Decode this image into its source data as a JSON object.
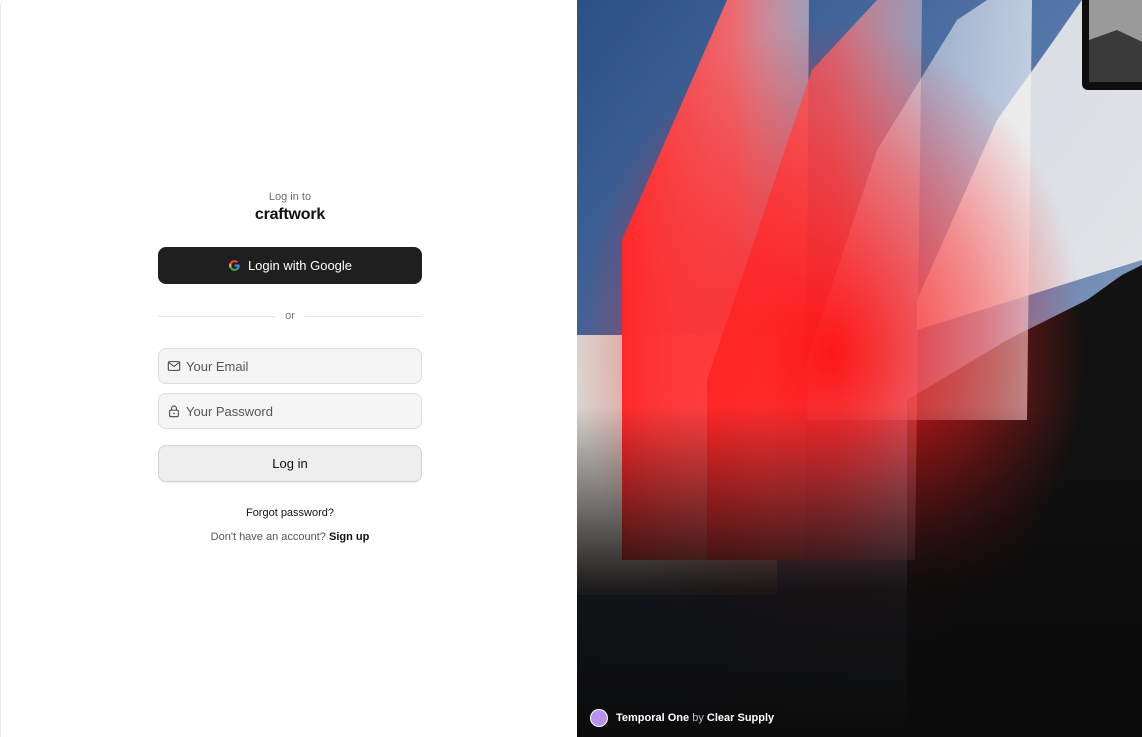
{
  "login": {
    "eyebrow": "Log in to",
    "brand": "craftwork",
    "google_button": "Login with Google",
    "divider": "or",
    "email_placeholder": "Your Email",
    "password_placeholder": "Your Password",
    "submit_button": "Log in",
    "forgot_link": "Forgot password?",
    "signup_prompt": "Don't have an account?",
    "signup_link": "Sign up"
  },
  "artwork": {
    "credit_title": "Temporal One",
    "credit_by": "by",
    "credit_author": "Clear Supply",
    "avatar_color": "#b892f0"
  },
  "icons": {
    "google": "google-icon",
    "email": "mail-icon",
    "password": "lock-icon"
  }
}
